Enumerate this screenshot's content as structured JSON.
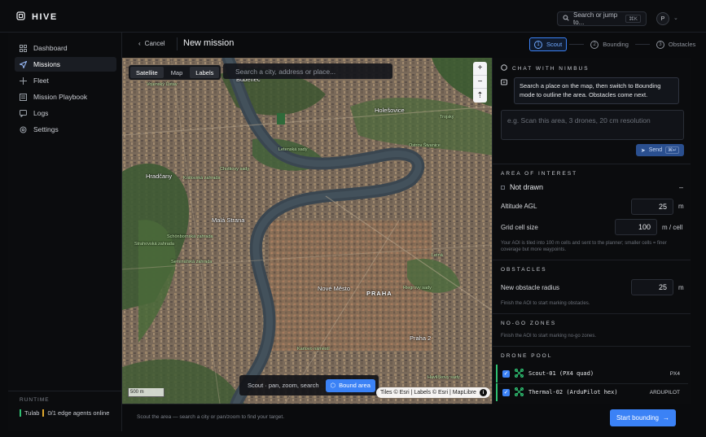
{
  "app": {
    "brand": "HIVE"
  },
  "topbar": {
    "search_label": "Search or jump to...",
    "search_shortcut": "⌘K",
    "avatar_initial": "P"
  },
  "sidebar": {
    "items": [
      {
        "label": "Dashboard",
        "icon": "grid-icon",
        "active": false
      },
      {
        "label": "Missions",
        "icon": "send-icon",
        "active": true
      },
      {
        "label": "Fleet",
        "icon": "drone-icon",
        "active": false
      },
      {
        "label": "Mission Playbook",
        "icon": "playbook-icon",
        "active": false
      },
      {
        "label": "Logs",
        "icon": "chat-icon",
        "active": false
      },
      {
        "label": "Settings",
        "icon": "gear-icon",
        "active": false
      }
    ],
    "runtime_title": "RUNTIME",
    "runtime_name": "Tulab",
    "runtime_status": "0/1 edge agents online"
  },
  "header": {
    "cancel_label": "Cancel",
    "title": "New mission",
    "steps": [
      {
        "num": "1",
        "label": "Scout",
        "active": true
      },
      {
        "num": "2",
        "label": "Bounding",
        "active": false
      },
      {
        "num": "3",
        "label": "Obstacles",
        "active": false
      }
    ]
  },
  "map": {
    "tabs": [
      {
        "label": "Satellite",
        "on": true
      },
      {
        "label": "Map",
        "on": false
      },
      {
        "label": "Labels",
        "on": true
      }
    ],
    "search_placeholder": "Search a city, address or place...",
    "zoom_in": "+",
    "zoom_out": "−",
    "compass": "⇡",
    "scale_label": "500 m",
    "mode_hint": "Scout · pan, zoom, search",
    "bound_button": "Bound area",
    "attribution": "Tiles © Esri | Labels © Esri | MapLibre",
    "labels": {
      "bubenec": "Bubeneč",
      "holesovice": "Holešovice",
      "hradcany": "Hradčany",
      "mala_strana": "Malá Strana",
      "nove_mesto": "Nové Město",
      "praha": "PRAHA",
      "praha2": "Praha 2",
      "troja": "Trojský",
      "mlynska": "Vojenský Ústav",
      "letenska": "Letenská sady",
      "chotkovy": "Chotkovy sady",
      "kralovska": "Královská zahrada",
      "schonborn": "Schönbornská zahrada",
      "strahovska": "Strahovská zahrada",
      "seminarska": "Seminářská zahrada",
      "karlovo": "Karlovo náměstí",
      "riegrovy": "Riegrovy sady",
      "havlickovy": "Havlíčkovy sady",
      "ostrov": "Ostrov Štvanice",
      "letna": "Letná"
    }
  },
  "footer": {
    "hint": "Scout the area — search a city or pan/zoom to find your target.",
    "start_button": "Start bounding"
  },
  "panel": {
    "chat_title": "CHAT WITH NIMBUS",
    "chat_message": "Search a place on the map, then switch to Bounding mode to outline the area. Obstacles come next.",
    "chat_placeholder": "e.g. Scan this area, 3 drones, 20 cm resolution",
    "send_label": "Send",
    "send_shortcut": "⌘↵",
    "aoi_title": "AREA OF INTEREST",
    "aoi_status": "Not drawn",
    "aoi_dash": "–",
    "altitude_label": "Altitude AGL",
    "altitude_value": "25",
    "altitude_unit": "m",
    "grid_label": "Grid cell size",
    "grid_value": "100",
    "grid_unit": "m / cell",
    "grid_hint": "Your AOI is tiled into 100 m cells and sent to the planner; smaller cells = finer coverage but more waypoints.",
    "obstacles_title": "OBSTACLES",
    "obstacle_radius_label": "New obstacle radius",
    "obstacle_radius_value": "25",
    "obstacle_radius_unit": "m",
    "obstacles_hint": "Finish the AOI to start marking obstacles.",
    "nogo_title": "NO-GO ZONES",
    "nogo_hint": "Finish the AOI to start marking no-go zones.",
    "drone_pool_title": "DRONE POOL",
    "drones": [
      {
        "name": "Scout-01 (PX4 quad)",
        "tag": "PX4"
      },
      {
        "name": "Thermal-02 (ArduPilot hex)",
        "tag": "ARDUPILOT"
      }
    ]
  },
  "colors": {
    "accent": "#3b82f6",
    "online": "#2fbf71",
    "bg": "#0a0b0d"
  }
}
